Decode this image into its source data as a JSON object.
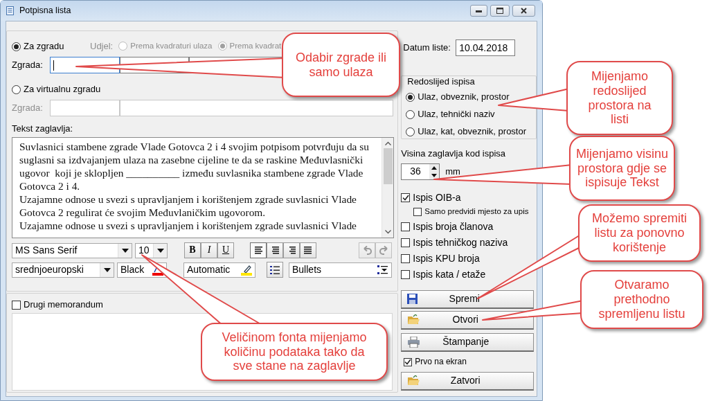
{
  "window": {
    "title": "Potpisna lista"
  },
  "sections": [
    {
      "radio_label": "Za zgradu",
      "selected": true,
      "field_label": "Zgrada:",
      "disabled": false,
      "fields": [
        {
          "focused": true
        },
        {
          "focused": false
        },
        {
          "focused": false
        }
      ]
    },
    {
      "radio_label": "Za virtualnu zgradu",
      "selected": false,
      "field_label": "Zgrada:",
      "disabled": true,
      "fields": [
        {
          "focused": false
        },
        {
          "focused": false
        }
      ]
    }
  ],
  "share": {
    "label": "Udjel:",
    "disabled": true,
    "options": [
      {
        "label": "Prema kvadraturi ulaza",
        "selected": false
      },
      {
        "label": "Prema kvadrat",
        "selected": true
      }
    ]
  },
  "header_text": {
    "label": "Tekst zaglavlja:",
    "paragraphs": [
      "Suvlasnici stambene zgrade Vlade Gotovca 2 i 4 svojim potpisom potvrđuju da su suglasni sa izdvajanjem ulaza na zasebne cijeline te da se raskine Međuvlasnički ugovor  koji je sklopljen __________ između suvlasnika stambene zgrade Vlade Gotovca 2 i 4.",
      "Uzajamne odnose u svezi s upravljanjem i korištenjem zgrade suvlasnici Vlade Gotovca 2 regulirat će svojim Međuvlaničkim ugovorom.",
      "Uzajamne odnose u svezi s upravljanjem i korištenjem zgrade suvlasnici Vlade"
    ]
  },
  "toolbar": {
    "font": "MS Sans Serif",
    "size": "10",
    "charset": "srednjoeuropski",
    "font_color": "Black",
    "highlight": "Automatic",
    "list_style": "Bullets",
    "styles": [
      {
        "kind": "bold",
        "label": "B"
      },
      {
        "kind": "italic",
        "label": "I"
      },
      {
        "kind": "underline",
        "label": "U"
      }
    ],
    "alignments": [
      {
        "kind": "left",
        "selected": true
      },
      {
        "kind": "center",
        "selected": false
      },
      {
        "kind": "right",
        "selected": false
      },
      {
        "kind": "justify",
        "selected": false
      }
    ],
    "history": [
      {
        "kind": "undo",
        "disabled": true
      },
      {
        "kind": "redo",
        "disabled": true
      }
    ]
  },
  "memo": {
    "label": "Drugi memorandum",
    "checked": false
  },
  "date": {
    "label": "Datum liste:",
    "value": "10.04.2018"
  },
  "order": {
    "title": "Redoslijed ispisa",
    "options": [
      {
        "label": "Ulaz, obveznik, prostor",
        "selected": true
      },
      {
        "label": "Ulaz, tehnički naziv",
        "selected": false
      },
      {
        "label": "Ulaz, kat, obveznik, prostor",
        "selected": false
      }
    ]
  },
  "header_height": {
    "label": "Visina zaglavlja kod ispisa",
    "value": "36",
    "unit": "mm"
  },
  "print_options": [
    {
      "label": "Ispis OIB-a",
      "checked": true,
      "kind": "main"
    },
    {
      "label": "Samo predvidi mjesto za upis",
      "checked": false,
      "kind": "sub"
    },
    {
      "label": "Ispis broja članova",
      "checked": false,
      "kind": "main"
    },
    {
      "label": "Ispis tehničkog naziva",
      "checked": false,
      "kind": "main"
    },
    {
      "label": "Ispis KPU broja",
      "checked": false,
      "kind": "main"
    },
    {
      "label": "Ispis kata / etaže",
      "checked": false,
      "kind": "main"
    }
  ],
  "buttons": [
    {
      "label": "Spremi",
      "kind": "save"
    },
    {
      "label": "Otvori",
      "kind": "open"
    },
    {
      "label": "Štampanje",
      "kind": "print"
    }
  ],
  "preview": {
    "label": "Prvo na ekran",
    "checked": true
  },
  "close_button": {
    "label": "Zatvori",
    "kind": "open"
  },
  "callouts": [
    "Odabir zgrade ili samo ulaza",
    "Mijenjamo redoslijed prostora na listi",
    "Mijenjamo visinu prostora gdje se ispisuje Tekst",
    "Možemo spremiti listu za ponovno korištenje",
    "Otvaramo prethodno spremljenu listu",
    "Veličinom fonta mijenjamo količinu podataka tako da sve stane na zaglavlje"
  ]
}
